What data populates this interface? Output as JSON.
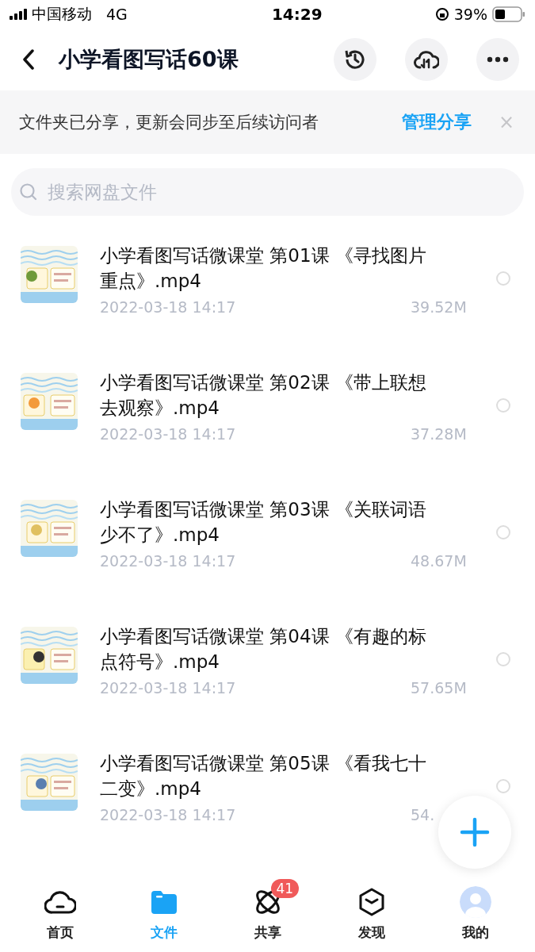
{
  "status_bar": {
    "carrier": "中国移动",
    "network": "4G",
    "time": "14:29",
    "battery": "39%"
  },
  "header": {
    "title": "小学看图写话60课"
  },
  "banner": {
    "text": "文件夹已分享，更新会同步至后续访问者",
    "link": "管理分享",
    "close": "×"
  },
  "search": {
    "placeholder": "搜索网盘文件"
  },
  "files": [
    {
      "name": "小学看图写话微课堂 第01课 《寻找图片重点》.mp4",
      "date": "2022-03-18 14:17",
      "size": "39.52M",
      "selected": false
    },
    {
      "name": "小学看图写话微课堂 第02课 《带上联想去观察》.mp4",
      "date": "2022-03-18 14:17",
      "size": "37.28M",
      "selected": false
    },
    {
      "name": "小学看图写话微课堂 第03课 《关联词语少不了》.mp4",
      "date": "2022-03-18 14:17",
      "size": "48.67M",
      "selected": false
    },
    {
      "name": "小学看图写话微课堂 第04课 《有趣的标点符号》.mp4",
      "date": "2022-03-18 14:17",
      "size": "57.65M",
      "selected": false
    },
    {
      "name": "小学看图写话微课堂 第05课 《看我七十二变》.mp4",
      "date": "2022-03-18 14:17",
      "size": "54.",
      "selected": false
    }
  ],
  "tab_bar": [
    {
      "kind": "home",
      "label": "首页",
      "selected": false
    },
    {
      "kind": "files",
      "label": "文件",
      "selected": true
    },
    {
      "kind": "share",
      "label": "共享",
      "selected": false,
      "badge": "41"
    },
    {
      "kind": "discover",
      "label": "发现",
      "selected": false
    },
    {
      "kind": "me",
      "label": "我的",
      "selected": false
    }
  ]
}
